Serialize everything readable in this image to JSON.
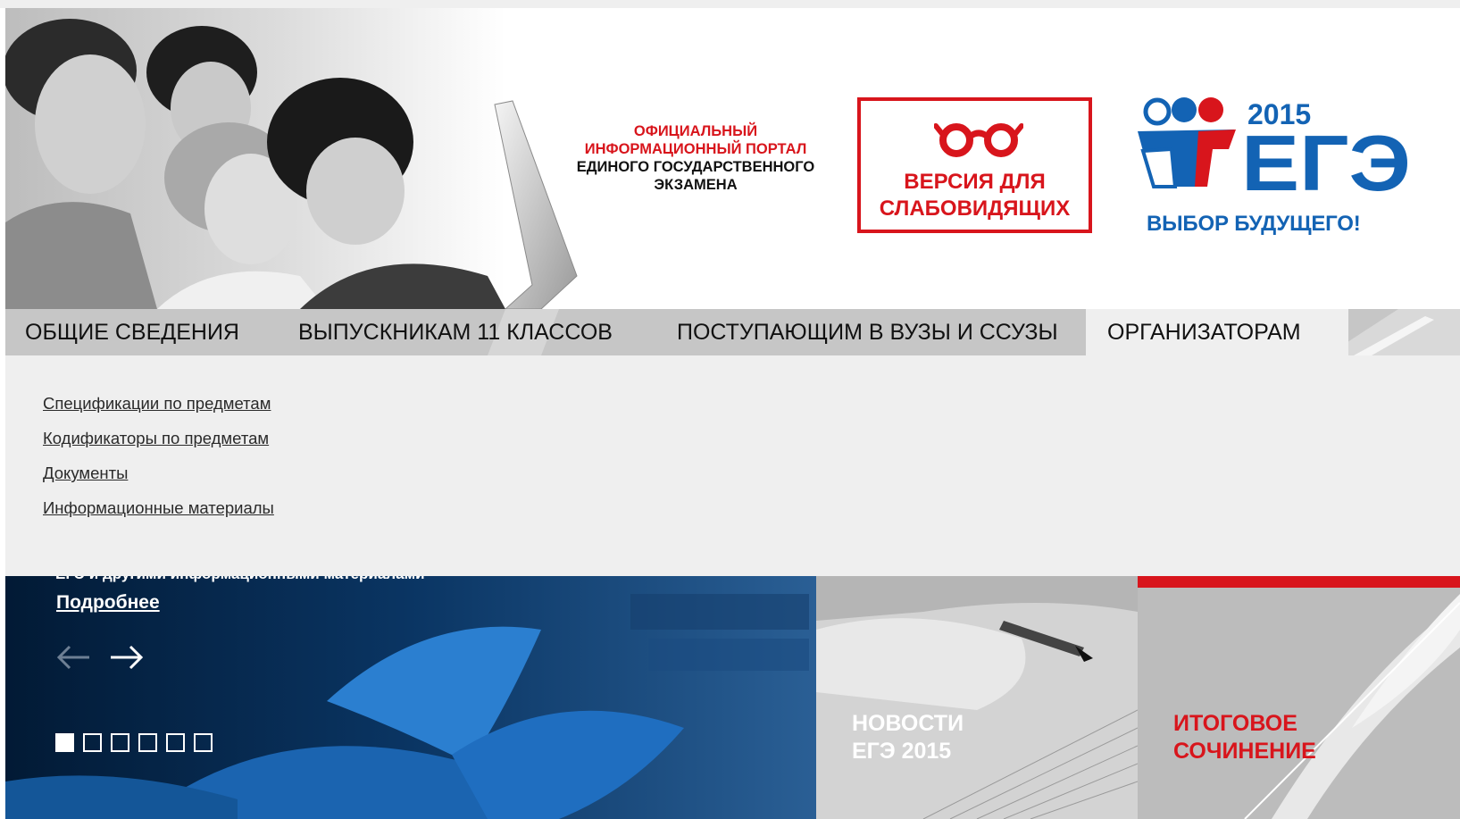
{
  "header": {
    "portal_title": {
      "line1": "ОФИЦИАЛЬНЫЙ",
      "line2": "ИНФОРМАЦИОННЫЙ ПОРТАЛ",
      "line3": "ЕДИНОГО ГОСУДАРСТВЕННОГО",
      "line4": "ЭКЗАМЕНА"
    },
    "low_vision": {
      "line1": "ВЕРСИЯ ДЛЯ",
      "line2": "СЛАБОВИДЯЩИХ"
    },
    "logo": {
      "year": "2015",
      "name": "ЕГЭ",
      "tagline": "ВЫБОР БУДУЩЕГО!"
    }
  },
  "nav": {
    "tabs": [
      {
        "label": "ОБЩИЕ СВЕДЕНИЯ"
      },
      {
        "label": "ВЫПУСКНИКАМ 11 КЛАССОВ"
      },
      {
        "label": "ПОСТУПАЮЩИМ В ВУЗЫ И ССУЗЫ"
      },
      {
        "label": "ОРГАНИЗАТОРАМ"
      }
    ]
  },
  "dropdown": {
    "links": [
      "Спецификации по предметам",
      "Кодификаторы по предметам",
      "Документы",
      "Информационные материалы"
    ]
  },
  "slider": {
    "cut_text": "ЕГЭ и другими информационными материалами",
    "more_label": "Подробнее",
    "dots_count": 6,
    "active_dot": 1
  },
  "tiles": {
    "news": {
      "line1": "НОВОСТИ",
      "line2": "ЕГЭ 2015"
    },
    "essay": {
      "line1": "ИТОГОВОЕ",
      "line2": "СОЧИНЕНИЕ"
    }
  },
  "colors": {
    "brand_red": "#d8151c",
    "brand_blue": "#1363b4",
    "nav_bg": "#c8c8c8",
    "dropdown_bg": "#efefef"
  },
  "icons": [
    "glasses-icon",
    "ege-logo-figures",
    "arrow-left-icon",
    "arrow-right-icon"
  ]
}
